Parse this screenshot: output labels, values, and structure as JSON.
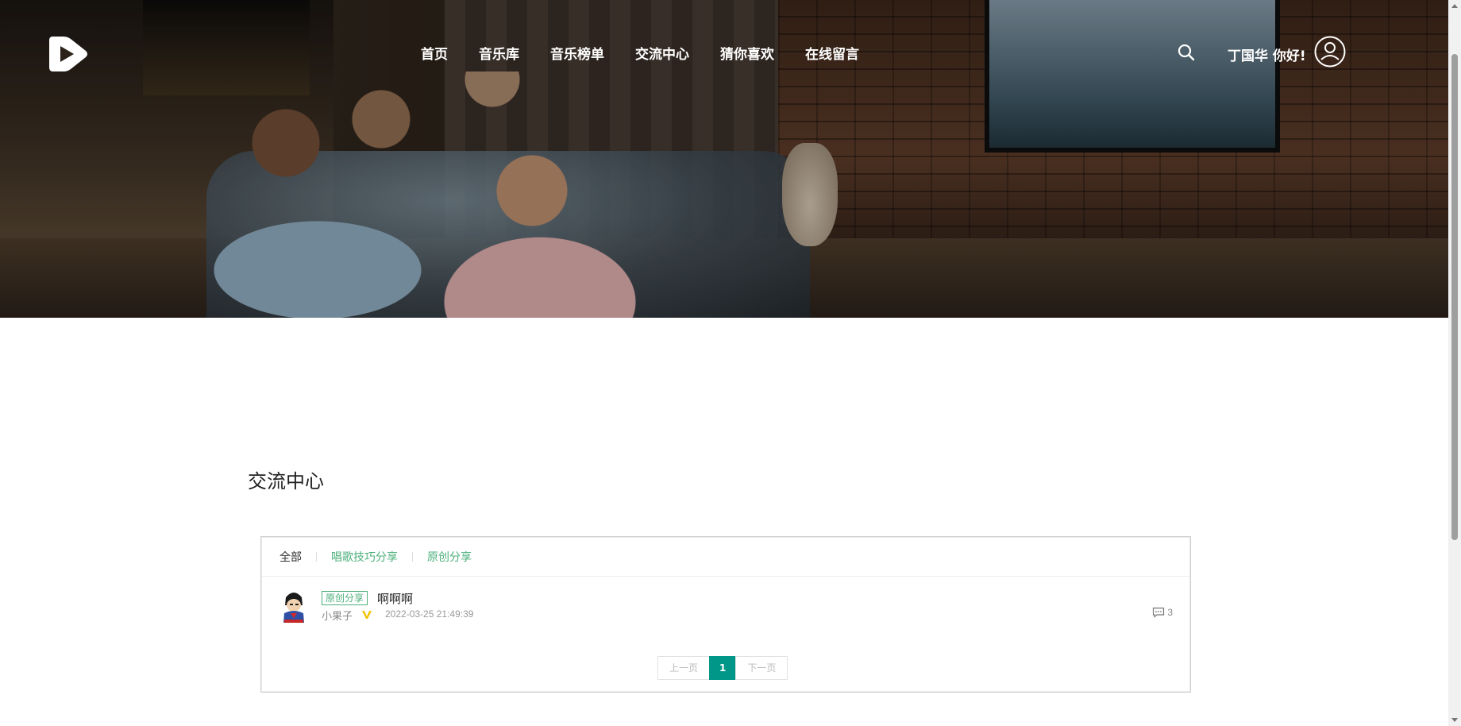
{
  "header": {
    "nav": [
      "首页",
      "音乐库",
      "音乐榜单",
      "交流中心",
      "猜你喜欢",
      "在线留言"
    ],
    "greeting": "丁国华 你好!",
    "logo_icon": "play-logo-icon",
    "search_icon": "search-icon",
    "user_icon": "user-circle-icon"
  },
  "main": {
    "title": "交流中心",
    "tabs": [
      {
        "label": "全部",
        "active": true
      },
      {
        "label": "唱歌技巧分享",
        "active": false
      },
      {
        "label": "原创分享",
        "active": false
      }
    ],
    "posts": [
      {
        "tag": "原创分享",
        "title": "啊啊啊",
        "author": "小果子",
        "time": "2022-03-25 21:49:39",
        "comments": "3"
      }
    ],
    "pagination": {
      "prev": "上一页",
      "current": "1",
      "next": "下一页"
    }
  },
  "colors": {
    "accent": "#4caf7a",
    "page_active": "#009688"
  }
}
